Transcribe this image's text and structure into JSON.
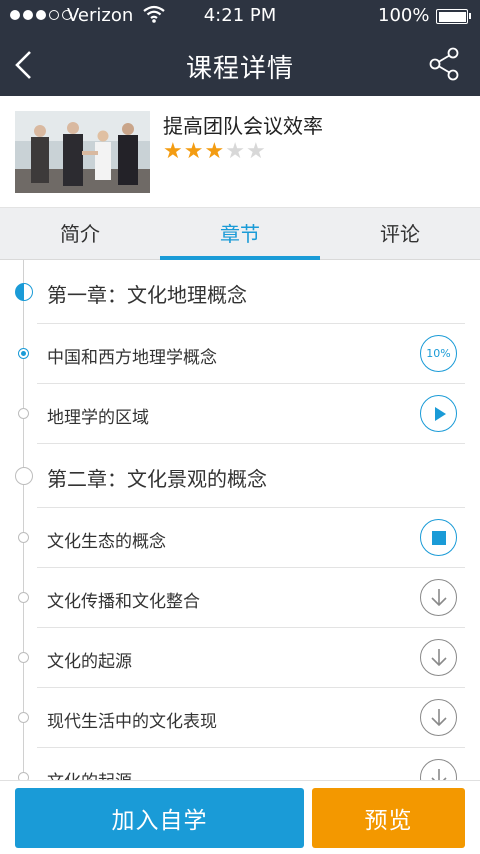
{
  "status_bar": {
    "carrier": "Verizon",
    "time": "4:21 PM",
    "battery": "100%"
  },
  "nav": {
    "title": "课程详情",
    "back_icon": "chevron-left-icon",
    "share_icon": "share-icon"
  },
  "course": {
    "title": "提高团队会议效率",
    "rating": 3,
    "rating_max": 5
  },
  "tabs": [
    {
      "label": "简介",
      "active": false
    },
    {
      "label": "章节",
      "active": true
    },
    {
      "label": "评论",
      "active": false
    }
  ],
  "chapters": [
    {
      "title": "第一章：文化地理概念",
      "lessons": [
        {
          "title": "中国和西方地理学概念",
          "action": "progress",
          "progress_label": "10%"
        },
        {
          "title": "地理学的区域",
          "action": "play"
        }
      ]
    },
    {
      "title": "第二章：文化景观的概念",
      "lessons": [
        {
          "title": "文化生态的概念",
          "action": "stop"
        },
        {
          "title": "文化传播和文化整合",
          "action": "download"
        },
        {
          "title": "文化的起源",
          "action": "download"
        },
        {
          "title": "现代生活中的文化表现",
          "action": "download"
        },
        {
          "title": "文化的起源",
          "action": "download"
        }
      ]
    }
  ],
  "buttons": {
    "join": "加入自学",
    "preview": "预览"
  },
  "colors": {
    "header_bg": "#2d3441",
    "accent": "#1a9bd7",
    "preview": "#f39800",
    "star": "#f39c12"
  }
}
